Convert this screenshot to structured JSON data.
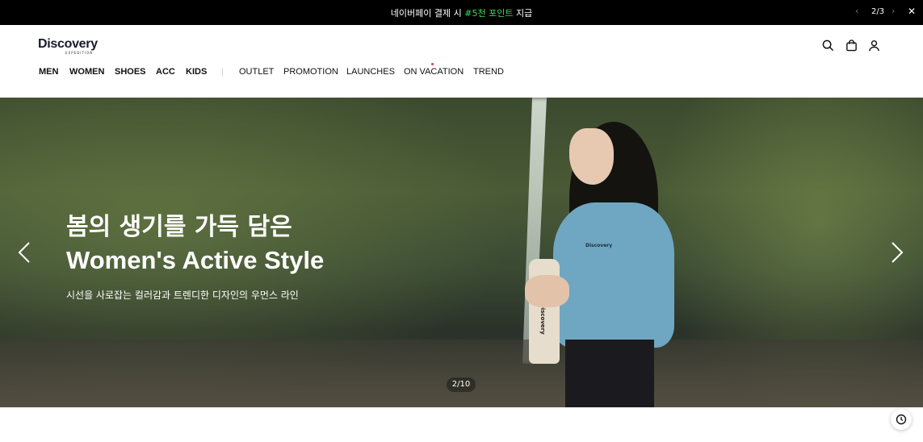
{
  "topbar": {
    "message_prefix": "네이버페이 결제 시 ",
    "message_highlight": "#5천 포인트",
    "message_suffix": " 지급",
    "pager": "2/3",
    "prev_icon": "chevron-left-icon",
    "next_icon": "chevron-right-icon",
    "close_icon": "close-icon"
  },
  "header": {
    "logo_text": "Discovery",
    "logo_subtext": "EXPEDITION",
    "icons": [
      "search-icon",
      "bag-icon",
      "user-icon"
    ]
  },
  "nav": {
    "main": [
      "MEN",
      "WOMEN",
      "SHOES",
      "ACC",
      "KIDS"
    ],
    "secondary": [
      "OUTLET",
      "PROMOTION",
      "LAUNCHES",
      "ON VACATION",
      "TREND"
    ]
  },
  "hero": {
    "title_line1": "봄의 생기를 가득 담은",
    "title_line2": "Women's Active Style",
    "subtitle": "시선을 사로잡는 컬러감과 트렌디한 디자인의 우먼스 라인",
    "slide_counter": "2/10",
    "jacket_logo": "Discovery",
    "bottle_logo": "Discovery"
  },
  "colors": {
    "topbar_bg": "#000000",
    "highlight": "#3ddc56",
    "nav_dot": "#ee3333"
  }
}
